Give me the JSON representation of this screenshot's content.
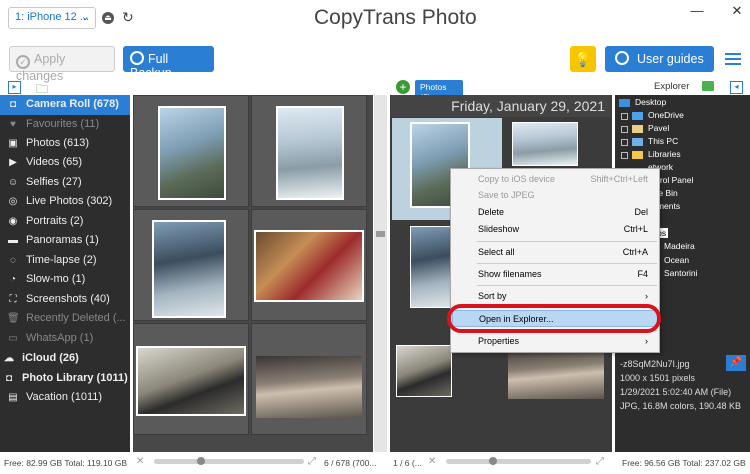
{
  "titlebar": {
    "device": "1: iPhone 12 ...",
    "app_title": "CopyTrans Photo",
    "minimize": "—",
    "close": "✕"
  },
  "toolbar": {
    "apply_label": "Apply changes",
    "backup_label": "Full Backup",
    "guides_label": "User guides"
  },
  "sidebar": {
    "items": [
      {
        "label": "Camera Roll (678)",
        "icon": "camera-icon"
      },
      {
        "label": "Favourites (11)",
        "icon": "heart-icon"
      },
      {
        "label": "Photos (613)",
        "icon": "photo-icon"
      },
      {
        "label": "Videos (65)",
        "icon": "video-icon"
      },
      {
        "label": "Selfies (27)",
        "icon": "selfie-icon"
      },
      {
        "label": "Live Photos (302)",
        "icon": "live-photo-icon"
      },
      {
        "label": "Portraits (2)",
        "icon": "portrait-icon"
      },
      {
        "label": "Panoramas (1)",
        "icon": "panorama-icon"
      },
      {
        "label": "Time-lapse (2)",
        "icon": "timelapse-icon"
      },
      {
        "label": "Slow-mo (1)",
        "icon": "slowmo-icon"
      },
      {
        "label": "Screenshots (40)",
        "icon": "screenshot-icon"
      },
      {
        "label": "Recently Deleted (...",
        "icon": "trash-icon"
      },
      {
        "label": "WhatsApp (1)",
        "icon": "folder-icon"
      },
      {
        "label": "iCloud (26)",
        "icon": "cloud-icon"
      },
      {
        "label": "Photo Library (1011)",
        "icon": "camera-icon"
      },
      {
        "label": "Vacation (1011)",
        "icon": "album-icon"
      }
    ]
  },
  "left_status": {
    "free": "Free: 82.99 GB Total: 119.10 GB",
    "count": "6 / 678 (700..."
  },
  "middle": {
    "tab_label": "Photos (6)",
    "date_header": "Friday, January 29, 2021",
    "status": "1 / 6 (..."
  },
  "context_menu": {
    "items": [
      {
        "label": "Copy to iOS device",
        "shortcut": "Shift+Ctrl+Left"
      },
      {
        "label": "Save to JPEG",
        "shortcut": ""
      },
      {
        "label": "Delete",
        "shortcut": "Del"
      },
      {
        "label": "Slideshow",
        "shortcut": "Ctrl+L"
      },
      {
        "label": "Select all",
        "shortcut": "Ctrl+A"
      },
      {
        "label": "Show filenames",
        "shortcut": "F4"
      },
      {
        "label": "Sort by",
        "shortcut": "›"
      },
      {
        "label": "Open in Explorer...",
        "shortcut": ""
      },
      {
        "label": "Properties",
        "shortcut": "›"
      }
    ]
  },
  "explorer": {
    "label": "Explorer",
    "tree": [
      {
        "label": "Desktop"
      },
      {
        "label": "OneDrive"
      },
      {
        "label": "Pavel"
      },
      {
        "label": "This PC"
      },
      {
        "label": "Libraries"
      },
      {
        "label": "etwork"
      },
      {
        "label": "ontrol Panel"
      },
      {
        "label": "ycle Bin"
      },
      {
        "label": "cuments"
      },
      {
        "label": "s"
      },
      {
        "label": "otos"
      },
      {
        "label": "Madeira"
      },
      {
        "label": "Ocean"
      },
      {
        "label": "Santorini"
      }
    ],
    "file_name": "-z8SqM2Nu7I.jpg",
    "file_dims": "1000 x 1501 pixels",
    "file_date": "1/29/2021 5:02:40 AM  (File)",
    "file_format": "JPG, 16.8M colors, 190.48 KB",
    "status": "Free: 96.56 GB Total: 237.02 GB"
  }
}
